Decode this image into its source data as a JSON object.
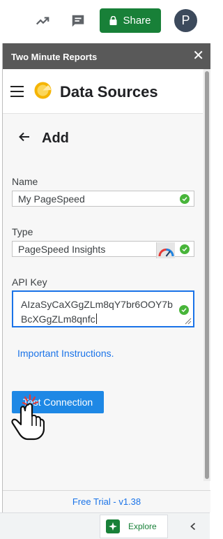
{
  "toolbar": {
    "share_label": "Share",
    "avatar_initial": "P"
  },
  "panel": {
    "title": "Two Minute Reports",
    "close_glyph": "✕"
  },
  "app": {
    "title": "Data Sources"
  },
  "add_page": {
    "heading": "Add",
    "fields": {
      "name": {
        "label": "Name",
        "value": "My PageSpeed"
      },
      "type": {
        "label": "Type",
        "value": "PageSpeed Insights"
      },
      "api_key": {
        "label": "API Key",
        "value": "AIzaSyCaXGgZLm8qY7br6OOY7bBcXGgZLm8qnfc"
      }
    },
    "instructions_link": "Important Instructions.",
    "test_button": "Test Connection"
  },
  "footer": {
    "version_text": "Free Trial - v1.38"
  },
  "bottombar": {
    "explore_label": "Explore"
  },
  "colors": {
    "share_green": "#188038",
    "panel_header": "#595959",
    "accent_blue": "#1a73e8",
    "button_blue": "#1e88e5",
    "check_green": "#48b53a"
  },
  "icons": [
    "trending-up-icon",
    "comment-icon",
    "lock-icon",
    "close-icon",
    "menu-icon",
    "logo-icon",
    "arrow-back-icon",
    "check-icon",
    "pagespeed-gauge-icon",
    "pointer-hand-icon",
    "explore-icon",
    "chevron-left-icon"
  ]
}
